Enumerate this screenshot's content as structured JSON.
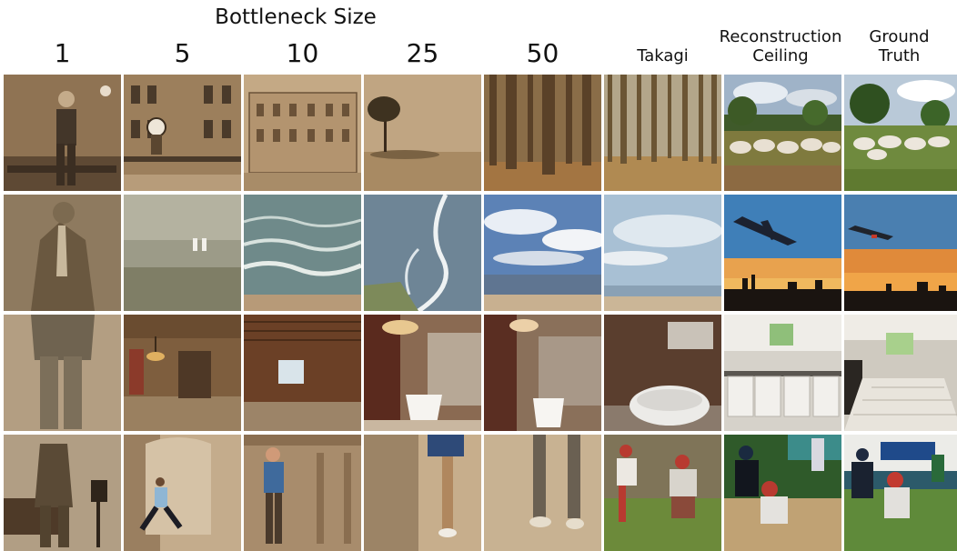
{
  "header": {
    "supertitle": "Bottleneck Size",
    "columns": [
      {
        "label": "1",
        "size": "big"
      },
      {
        "label": "5",
        "size": "big"
      },
      {
        "label": "10",
        "size": "big"
      },
      {
        "label": "25",
        "size": "big"
      },
      {
        "label": "50",
        "size": "big"
      },
      {
        "label": "Takagi",
        "size": "small"
      },
      {
        "label": "Reconstruction Ceiling",
        "line1": "Reconstruction",
        "line2": "Ceiling",
        "size": "small"
      },
      {
        "label": "Ground Truth",
        "line1": "Ground",
        "line2": "Truth",
        "size": "small"
      }
    ]
  },
  "rows": [
    {
      "subject": "standing-man-portrait",
      "cells": [
        "sepia-man",
        "sepia-building-clock",
        "sepia-building-sketch",
        "lone-tree-field",
        "forest-trunks",
        "forest-trunks",
        "cows-meadow",
        "cows-meadow"
      ]
    },
    {
      "subject": "sky-sea",
      "cells": [
        "sepia-suit",
        "feet-in-grass",
        "ocean-waves",
        "surf-shoreline",
        "sea-cloudy-sky",
        "sea-pale-sky",
        "airplane-sunset",
        "airplane-sunset"
      ]
    },
    {
      "subject": "interior-room",
      "cells": [
        "sepia-suit-pants",
        "wooden-room-chandelier",
        "wooden-room-window",
        "bathroom-tub",
        "bathroom-tub",
        "bathroom-tub-closeup",
        "kitchen-white",
        "kitchen-tiled"
      ]
    },
    {
      "subject": "figure-action",
      "cells": [
        "sepia-man-camera",
        "man-running-hall",
        "man-standing-hall",
        "legs-by-wall",
        "legs-feet",
        "baseball-players",
        "baseball-catcher",
        "baseball-pitch"
      ]
    }
  ],
  "colors": {
    "sepia": "#a38866",
    "sky_blue": "#5c82b6",
    "sunset_orange": "#e08a3a",
    "grass_green": "#6f8a3e"
  }
}
